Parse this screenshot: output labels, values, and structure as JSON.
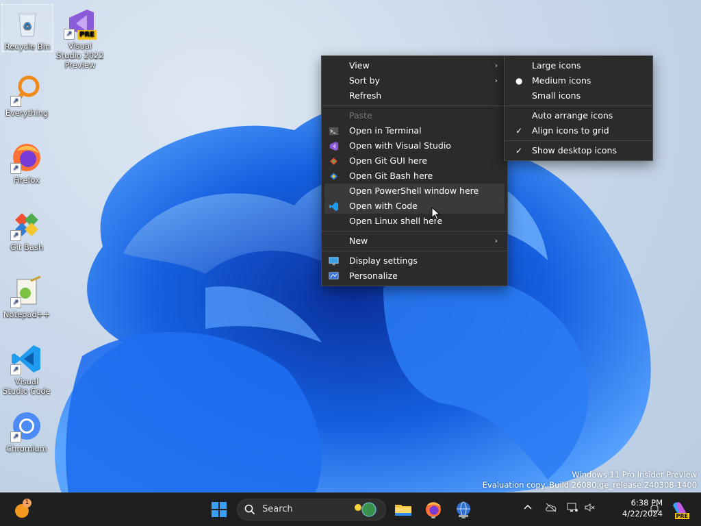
{
  "desktop": {
    "icons": [
      {
        "label": "Recycle Bin"
      },
      {
        "label": "Visual Studio 2022 Preview",
        "badge": "PRE"
      },
      {
        "label": "Everything"
      },
      {
        "label": "Firefox"
      },
      {
        "label": "Git Bash"
      },
      {
        "label": "Notepad++"
      },
      {
        "label": "Visual Studio Code"
      },
      {
        "label": "Chromium"
      }
    ]
  },
  "context_menu": {
    "items": [
      {
        "label": "View"
      },
      {
        "label": "Sort by"
      },
      {
        "label": "Refresh"
      },
      {
        "label": "Paste"
      },
      {
        "label": "Open in Terminal"
      },
      {
        "label": "Open with Visual Studio"
      },
      {
        "label": "Open Git GUI here"
      },
      {
        "label": "Open Git Bash here"
      },
      {
        "label": "Open PowerShell window here"
      },
      {
        "label": "Open with Code"
      },
      {
        "label": "Open Linux shell here"
      },
      {
        "label": "New"
      },
      {
        "label": "Display settings"
      },
      {
        "label": "Personalize"
      }
    ],
    "arrow": "›"
  },
  "view_submenu": {
    "items": [
      {
        "label": "Large icons"
      },
      {
        "label": "Medium icons",
        "mark": "●"
      },
      {
        "label": "Small icons"
      },
      {
        "label": "Auto arrange icons"
      },
      {
        "label": "Align icons to grid",
        "mark": "✓"
      },
      {
        "label": "Show desktop icons",
        "mark": "✓"
      }
    ]
  },
  "watermark": {
    "line1": "Windows 11 Pro Insider Preview",
    "line2": "Evaluation copy. Build 26080.ge_release.240308-1400"
  },
  "taskbar": {
    "notification_count": "1",
    "search_label": "Search",
    "copilot_badge": "PRE",
    "time": "6:38 PM",
    "date": "4/22/2024"
  },
  "colors": {
    "menu_bg": "#2b2b2b",
    "taskbar_bg": "#1f1f1f",
    "accent_blue": "#1a6fe8"
  }
}
